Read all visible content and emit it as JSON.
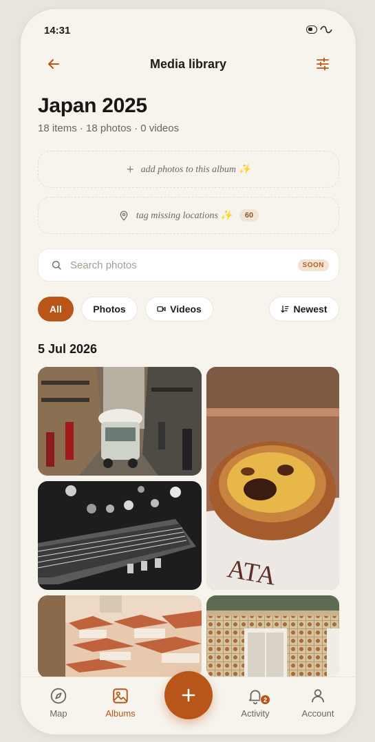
{
  "status_bar": {
    "time": "14:31"
  },
  "header": {
    "title": "Media library"
  },
  "album": {
    "title": "Japan 2025",
    "subtitle": "18 items · 18 photos · 0 videos"
  },
  "actions": {
    "add_photos": "add photos to this album ✨",
    "tag_locations": "tag missing locations ✨",
    "missing_count": "60"
  },
  "search": {
    "placeholder": "Search photos",
    "badge": "SOON"
  },
  "filters": {
    "all": "All",
    "photos": "Photos",
    "videos": "Videos",
    "sort": "Newest"
  },
  "section": {
    "date": "5 Jul 2026"
  },
  "photos": [
    {
      "name": "tram-street",
      "subject": "street with tuk-tuk"
    },
    {
      "name": "pastel-de-nata",
      "subject": "custard tart"
    },
    {
      "name": "guitar-bw",
      "subject": "guitar neck in black and white"
    },
    {
      "name": "city-rooftops",
      "subject": "hillside rooftops"
    },
    {
      "name": "tiled-facade",
      "subject": "tiled building facade"
    }
  ],
  "nav": {
    "map": "Map",
    "albums": "Albums",
    "activity": "Activity",
    "activity_badge": "2",
    "account": "Account"
  },
  "colors": {
    "accent": "#b8561a",
    "background": "#f7f3ed",
    "text": "#1a1613",
    "muted": "#6e655c"
  }
}
